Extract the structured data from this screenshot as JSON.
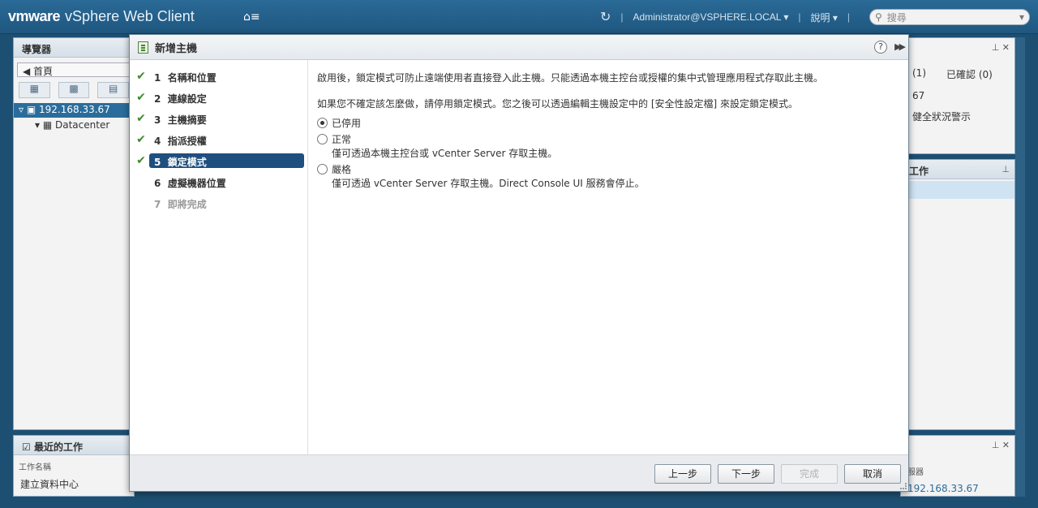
{
  "header": {
    "brand_vm": "vmware",
    "brand_product": "vSphere Web Client",
    "home_icon": "home-menu-icon",
    "user": "Administrator@VSPHERE.LOCAL",
    "help": "說明",
    "search_placeholder": "搜尋"
  },
  "navigator": {
    "title": "導覽器",
    "home": "首頁",
    "tree": [
      {
        "label": "192.168.33.67"
      },
      {
        "label": "Datacenter"
      }
    ]
  },
  "right_top": {
    "partial1": "(1)",
    "confirmed": "已確認 (0)",
    "partial2": "67",
    "partial3": "健全狀況警示"
  },
  "right_mid": {
    "title_partial": "工作"
  },
  "recent_tasks": {
    "title": "最近的工作",
    "col_task_name": "工作名稱",
    "row_task": "建立資料中心",
    "col_server_partial": "服器",
    "row_server": "192.168.33.67"
  },
  "dialog": {
    "title": "新增主機",
    "help": "?",
    "steps": [
      {
        "num": "1",
        "label": "名稱和位置",
        "done": true
      },
      {
        "num": "2",
        "label": "連線設定",
        "done": true
      },
      {
        "num": "3",
        "label": "主機摘要",
        "done": true
      },
      {
        "num": "4",
        "label": "指派授權",
        "done": true
      },
      {
        "num": "5",
        "label": "鎖定模式",
        "done": true,
        "active": true
      },
      {
        "num": "6",
        "label": "虛擬機器位置",
        "done": false
      },
      {
        "num": "7",
        "label": "即將完成",
        "done": false,
        "disabled": true
      }
    ],
    "para1": "啟用後，鎖定模式可防止遠端使用者直接登入此主機。只能透過本機主控台或授權的集中式管理應用程式存取此主機。",
    "para2": "如果您不確定該怎麼做，請停用鎖定模式。您之後可以透過編輯主機設定中的 [安全性設定檔] 來設定鎖定模式。",
    "options": [
      {
        "label": "已停用",
        "desc": "",
        "checked": true
      },
      {
        "label": "正常",
        "desc": "僅可透過本機主控台或 vCenter Server 存取主機。",
        "checked": false
      },
      {
        "label": "嚴格",
        "desc": "僅可透過 vCenter Server 存取主機。Direct Console UI 服務會停止。",
        "checked": false
      }
    ],
    "buttons": {
      "back": "上一步",
      "next": "下一步",
      "finish": "完成",
      "cancel": "取消"
    }
  }
}
